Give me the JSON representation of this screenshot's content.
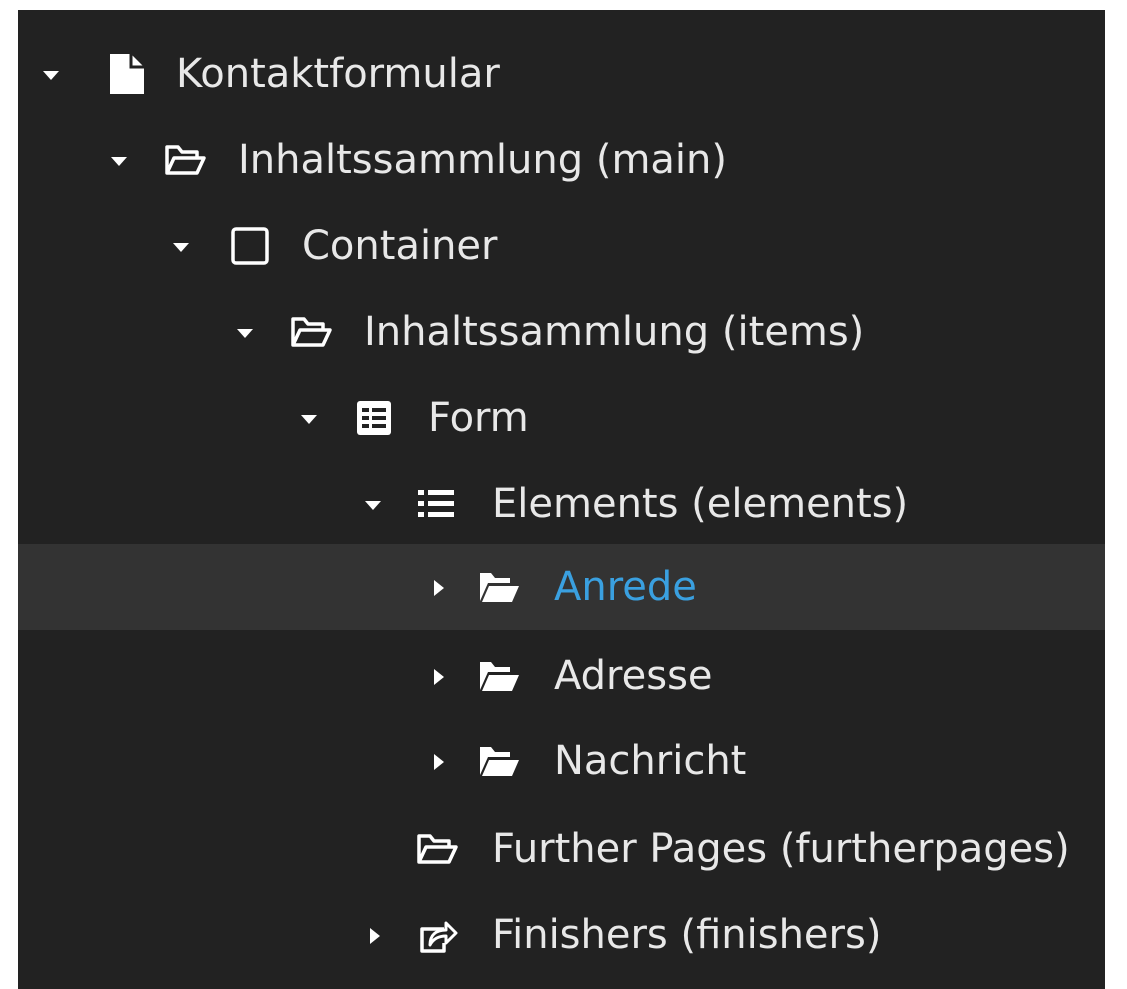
{
  "tree": {
    "nodes": [
      {
        "label": "Kontaktformular",
        "icon": "file-icon",
        "state": "expanded"
      },
      {
        "label": "Inhaltssammlung (main)",
        "icon": "folder-open-outline-icon",
        "state": "expanded"
      },
      {
        "label": "Container",
        "icon": "square-outline-icon",
        "state": "expanded"
      },
      {
        "label": "Inhaltssammlung (items)",
        "icon": "folder-open-outline-icon",
        "state": "expanded"
      },
      {
        "label": "Form",
        "icon": "form-list-icon",
        "state": "expanded"
      },
      {
        "label": "Elements (elements)",
        "icon": "list-icon",
        "state": "expanded"
      },
      {
        "label": "Anrede",
        "icon": "folder-open-solid-icon",
        "state": "collapsed",
        "selected": true
      },
      {
        "label": "Adresse",
        "icon": "folder-open-solid-icon",
        "state": "collapsed"
      },
      {
        "label": "Nachricht",
        "icon": "folder-open-solid-icon",
        "state": "collapsed"
      },
      {
        "label": "Further Pages (furtherpages)",
        "icon": "folder-open-outline-icon",
        "state": "leaf"
      },
      {
        "label": "Finishers (finishers)",
        "icon": "share-icon",
        "state": "collapsed"
      }
    ]
  },
  "colors": {
    "panel_background": "#222222",
    "selected_row_background": "#333333",
    "text": "#e8e8e8",
    "selected_text": "#3aa0e0"
  }
}
